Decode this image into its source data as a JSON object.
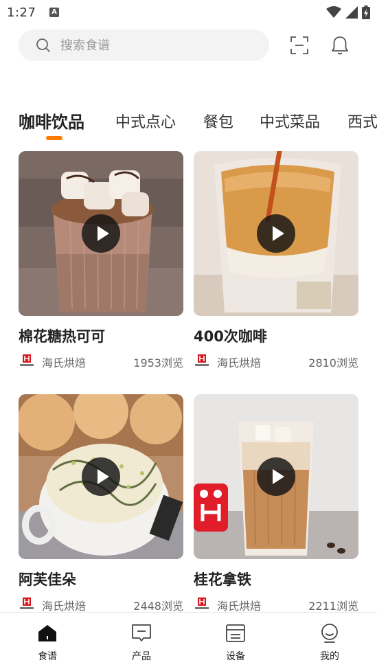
{
  "status_bar": {
    "time": "1:27",
    "notification_letter": "A"
  },
  "search": {
    "placeholder": "搜索食谱"
  },
  "tabs": [
    {
      "label": "咖啡饮品",
      "active": true
    },
    {
      "label": "中式点心",
      "active": false
    },
    {
      "label": "餐包",
      "active": false
    },
    {
      "label": "中式菜品",
      "active": false
    },
    {
      "label": "西式",
      "active": false
    }
  ],
  "accent_color": "#ff7a00",
  "recipes": [
    {
      "title": "棉花糖热可可",
      "brand": "海氏烘焙",
      "views": "1953浏览"
    },
    {
      "title": "400次咖啡",
      "brand": "海氏烘焙",
      "views": "2810浏览"
    },
    {
      "title": "阿芙佳朵",
      "brand": "海氏烘焙",
      "views": "2448浏览"
    },
    {
      "title": "桂花拿铁",
      "brand": "海氏烘焙",
      "views": "2211浏览"
    }
  ],
  "bottom_nav": [
    {
      "label": "食谱",
      "icon": "home-icon",
      "active": true
    },
    {
      "label": "产品",
      "icon": "message-icon",
      "active": false
    },
    {
      "label": "设备",
      "icon": "device-icon",
      "active": false
    },
    {
      "label": "我的",
      "icon": "profile-icon",
      "active": false
    }
  ]
}
